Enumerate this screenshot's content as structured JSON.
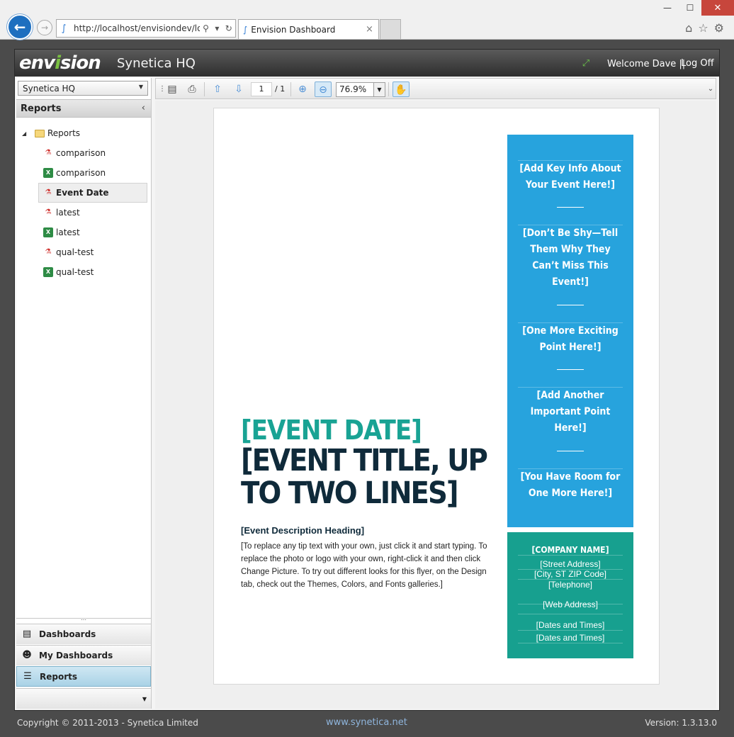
{
  "browser": {
    "address": "http://localhost/envisiondev/log",
    "tab_title": "Envision Dashboard",
    "win_min": "—",
    "win_max": "☐",
    "win_close": "✕",
    "tab_close": "×"
  },
  "header": {
    "logo_a": "env",
    "logo_dot": "i",
    "logo_b": "sion",
    "company": "Synetica HQ",
    "welcome": "Welcome Dave ||",
    "logoff": "Log Off"
  },
  "left": {
    "site_select": "Synetica HQ",
    "panel_title": "Reports",
    "tree_root": "Reports",
    "items": [
      {
        "label": "comparison",
        "type": "pdf"
      },
      {
        "label": "comparison",
        "type": "xls"
      },
      {
        "label": "Event Date",
        "type": "pdf"
      },
      {
        "label": "latest",
        "type": "pdf"
      },
      {
        "label": "latest",
        "type": "xls"
      },
      {
        "label": "qual-test",
        "type": "pdf"
      },
      {
        "label": "qual-test",
        "type": "xls"
      }
    ],
    "selected": "Event Date",
    "nav": {
      "dashboards": "Dashboards",
      "my_dashboards": "My Dashboards",
      "reports": "Reports"
    }
  },
  "viewer": {
    "page_current": "1",
    "page_total": "/ 1",
    "zoom": "76.9%"
  },
  "document": {
    "event_date": "[EVENT DATE]",
    "event_title": "[EVENT TITLE, UP TO TWO LINES]",
    "desc_heading": "[Event Description Heading]",
    "desc_body": "[To replace any tip text with your own, just click it and start typing. To replace the photo or logo with your own, right-click it and then click Change Picture. To try out different looks for this flyer, on the Design tab, check out the Themes, Colors, and Fonts galleries.]",
    "sidebar_points": [
      "[Add Key Info About Your Event Here!]",
      "[Don’t Be Shy—Tell Them Why They Can’t Miss This Event!]",
      "[One More Exciting Point Here!]",
      "[Add Another Important Point Here!]",
      "[You Have Room for One More Here!]"
    ],
    "company_name": "[COMPANY NAME]",
    "street": "[Street Address]",
    "city": "[City, ST  ZIP Code]",
    "telephone": "[Telephone]",
    "web": "[Web Address]",
    "dates1": "[Dates and Times]",
    "dates2": "[Dates and Times]"
  },
  "footer": {
    "copyright": "Copyright © 2011-2013 - Synetica Limited",
    "site": "www.synetica.net",
    "version": "Version: 1.3.13.0"
  },
  "colors": {
    "teal": "#19a394",
    "navy": "#0f2a3a",
    "blue_panel": "#27a3dd",
    "green_panel": "#17a08f"
  }
}
